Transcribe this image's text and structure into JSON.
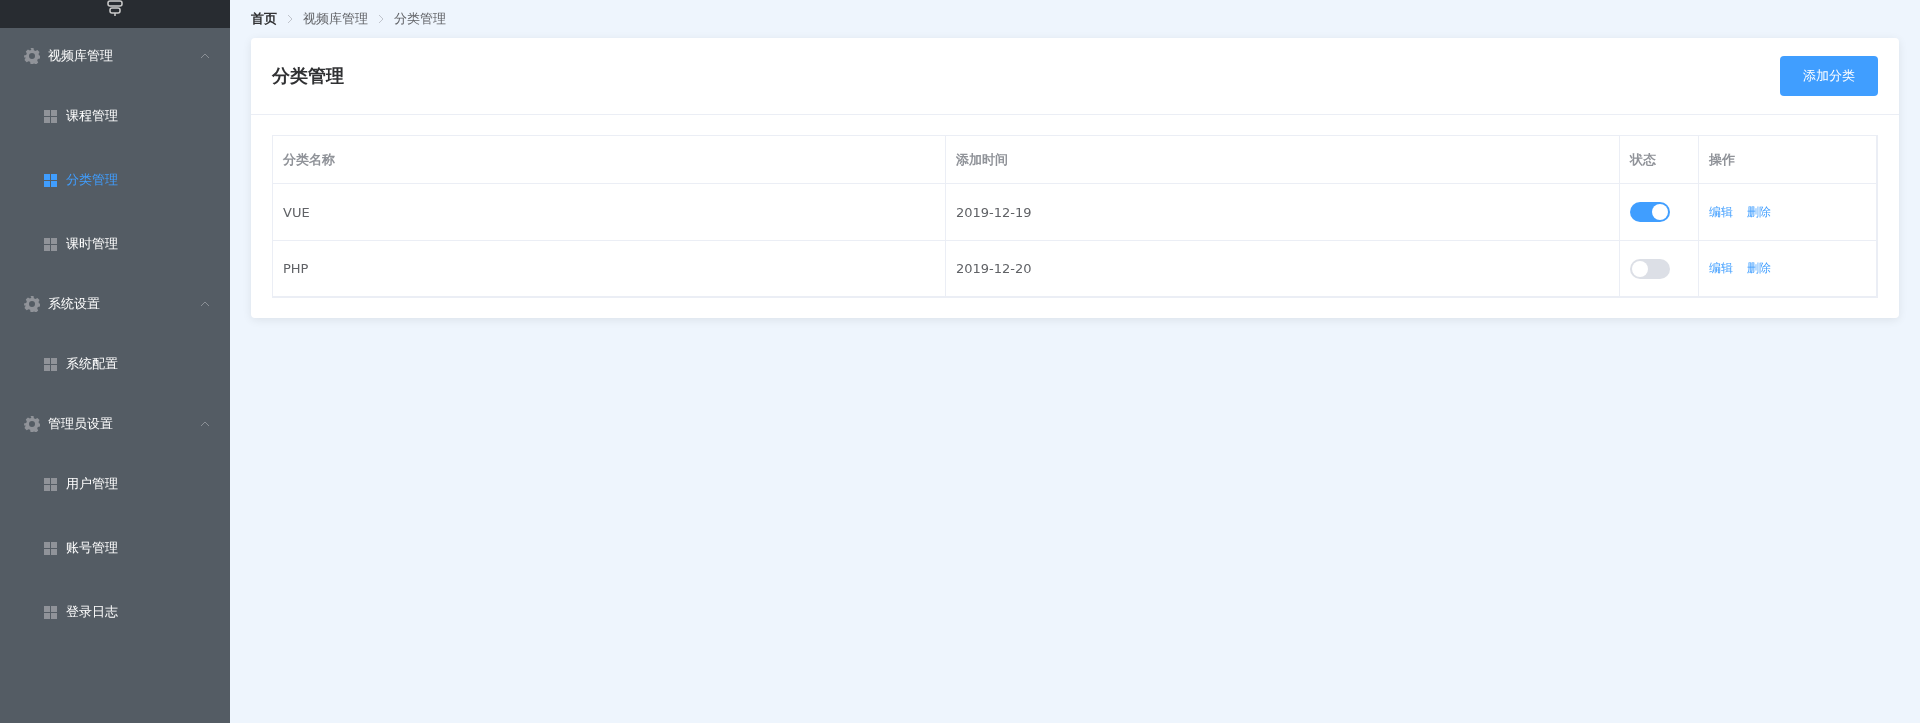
{
  "sidebar": {
    "groups": [
      {
        "title": "视频库管理",
        "expanded": true,
        "items": [
          {
            "label": "课程管理",
            "selected": false
          },
          {
            "label": "分类管理",
            "selected": true
          },
          {
            "label": "课时管理",
            "selected": false
          }
        ]
      },
      {
        "title": "系统设置",
        "expanded": true,
        "items": [
          {
            "label": "系统配置",
            "selected": false
          }
        ]
      },
      {
        "title": "管理员设置",
        "expanded": true,
        "items": [
          {
            "label": "用户管理",
            "selected": false
          },
          {
            "label": "账号管理",
            "selected": false
          },
          {
            "label": "登录日志",
            "selected": false
          }
        ]
      }
    ]
  },
  "breadcrumb": [
    "首页",
    "视频库管理",
    "分类管理"
  ],
  "card": {
    "title": "分类管理",
    "add_button": "添加分类"
  },
  "table": {
    "columns": [
      "分类名称",
      "添加时间",
      "状态",
      "操作"
    ],
    "rows": [
      {
        "name": "VUE",
        "date": "2019-12-19",
        "on": true,
        "actions": [
          "编辑",
          "删除"
        ]
      },
      {
        "name": "PHP",
        "date": "2019-12-20",
        "on": false,
        "actions": [
          "编辑",
          "删除"
        ]
      }
    ]
  }
}
